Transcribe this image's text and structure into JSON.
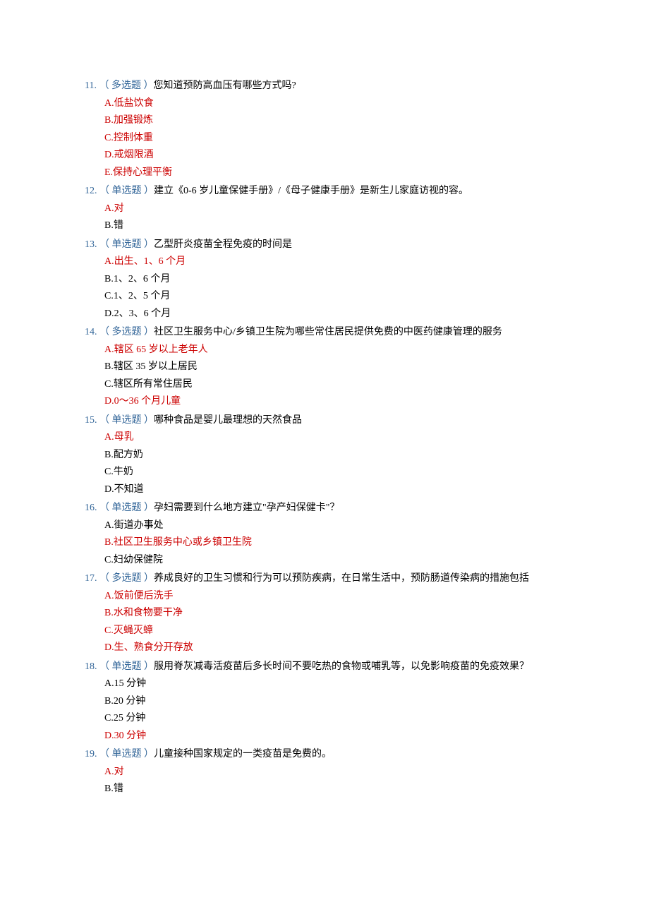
{
  "questions": [
    {
      "num": "11. ",
      "type": "（ 多选题 ）",
      "text": "您知道预防高血压有哪些方式吗?",
      "options": [
        {
          "label": "A.低盐饮食",
          "correct": true
        },
        {
          "label": "B.加强锻炼",
          "correct": true
        },
        {
          "label": "C.控制体重",
          "correct": true
        },
        {
          "label": "D.戒烟限酒",
          "correct": true
        },
        {
          "label": "E.保持心理平衡",
          "correct": true
        }
      ]
    },
    {
      "num": "12. ",
      "type": "（ 单选题 ）",
      "text": "建立《0-6 岁儿童保健手册》/《母子健康手册》是新生儿家庭访视的容。",
      "options": [
        {
          "label": "A.对",
          "correct": true
        },
        {
          "label": "B.错",
          "correct": false
        }
      ]
    },
    {
      "num": "13. ",
      "type": "（ 单选题 ）",
      "text": "乙型肝炎疫苗全程免疫的时间是",
      "options": [
        {
          "label": "A.出生、1、6 个月",
          "correct": true
        },
        {
          "label": "B.1、2、6 个月",
          "correct": false
        },
        {
          "label": "C.1、2、5 个月",
          "correct": false
        },
        {
          "label": "D.2、3、6 个月",
          "correct": false
        }
      ]
    },
    {
      "num": "14. ",
      "type": "（ 多选题 ）",
      "text": "社区卫生服务中心/乡镇卫生院为哪些常住居民提供免费的中医药健康管理的服务",
      "options": [
        {
          "label": "A.辖区 65 岁以上老年人",
          "correct": true
        },
        {
          "label": "B.辖区 35 岁以上居民",
          "correct": false
        },
        {
          "label": "C.辖区所有常住居民",
          "correct": false
        },
        {
          "label": "D.0～36 个月儿童",
          "correct": true
        }
      ]
    },
    {
      "num": "15. ",
      "type": "（ 单选题 ）",
      "text": "哪种食品是婴儿最理想的天然食品",
      "options": [
        {
          "label": "A.母乳",
          "correct": true
        },
        {
          "label": "B.配方奶",
          "correct": false
        },
        {
          "label": "C.牛奶",
          "correct": false
        },
        {
          "label": "D.不知道",
          "correct": false
        }
      ]
    },
    {
      "num": "16. ",
      "type": "（ 单选题 ）",
      "text": "孕妇需要到什么地方建立\"孕产妇保健卡\"？",
      "options": [
        {
          "label": "A.街道办事处",
          "correct": false
        },
        {
          "label": "B.社区卫生服务中心或乡镇卫生院",
          "correct": true
        },
        {
          "label": "C.妇幼保健院",
          "correct": false
        }
      ]
    },
    {
      "num": "17. ",
      "type": "（ 多选题 ）",
      "text": "养成良好的卫生习惯和行为可以预防疾病，在日常生活中，预防肠道传染病的措施包括",
      "options": [
        {
          "label": "A.饭前便后洗手",
          "correct": true
        },
        {
          "label": "B.水和食物要干净",
          "correct": true
        },
        {
          "label": "C.灭蝇灭蟑",
          "correct": true
        },
        {
          "label": "D.生、熟食分开存放",
          "correct": true
        }
      ]
    },
    {
      "num": "18. ",
      "type": "（ 单选题 ）",
      "text": "服用脊灰减毒活疫苗后多长时间不要吃热的食物或哺乳等，以免影响疫苗的免疫效果？",
      "options": [
        {
          "label": "A.15 分钟",
          "correct": false
        },
        {
          "label": "B.20 分钟",
          "correct": false
        },
        {
          "label": "C.25 分钟",
          "correct": false
        },
        {
          "label": "D.30 分钟",
          "correct": true
        }
      ]
    },
    {
      "num": "19. ",
      "type": "（ 单选题 ）",
      "text": "儿童接种国家规定的一类疫苗是免费的。",
      "options": [
        {
          "label": "A.对",
          "correct": true
        },
        {
          "label": "B.错",
          "correct": false
        }
      ]
    }
  ]
}
